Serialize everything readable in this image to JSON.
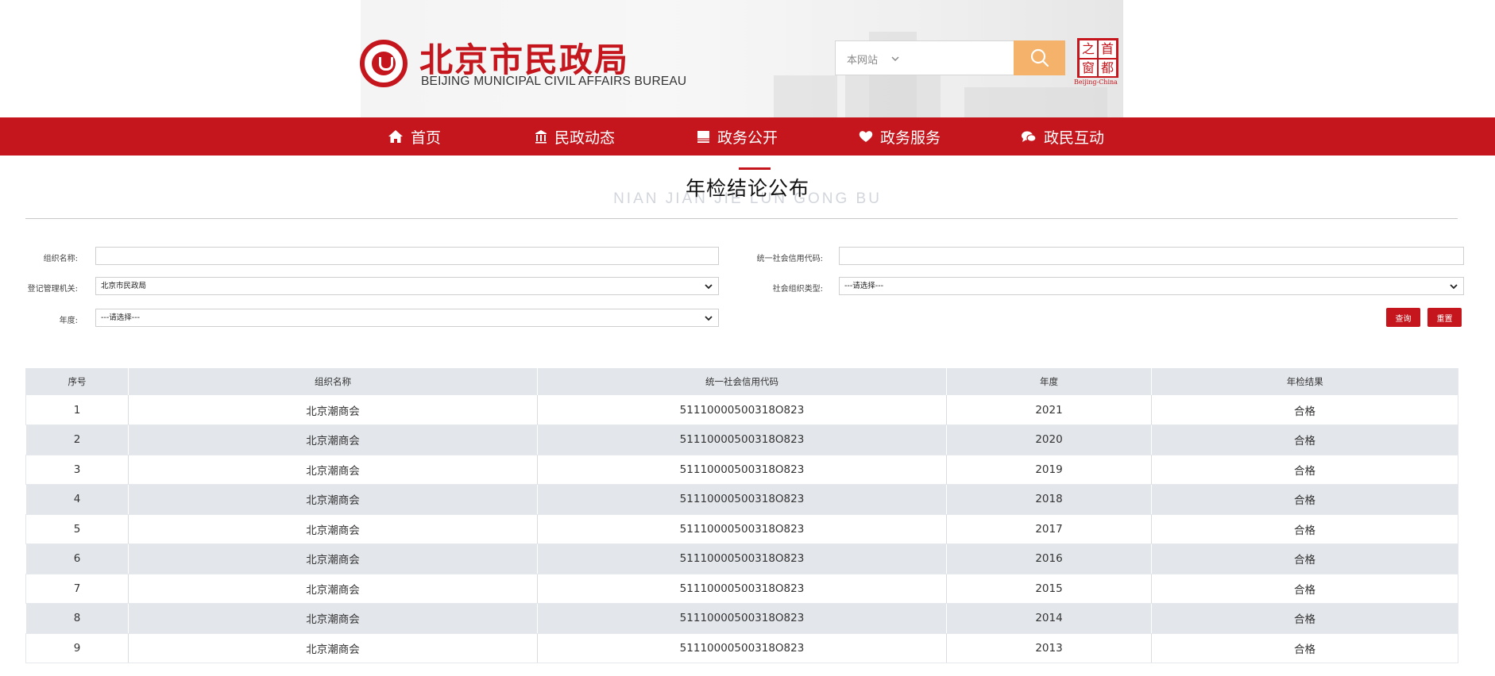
{
  "header": {
    "logo_cn": "北京市民政局",
    "logo_en": "BEIJING MUNICIPAL CIVIL AFFAIRS BUREAU",
    "search_scope": "本网站",
    "capital_logo": [
      "之",
      "首",
      "窗",
      "都"
    ],
    "capital_logo_sub": "Beijing-China"
  },
  "nav": {
    "items": [
      {
        "label": "首页",
        "icon": "home-icon"
      },
      {
        "label": "民政动态",
        "icon": "building-icon"
      },
      {
        "label": "政务公开",
        "icon": "book-icon"
      },
      {
        "label": "政务服务",
        "icon": "heart-icon"
      },
      {
        "label": "政民互动",
        "icon": "chat-icon"
      }
    ]
  },
  "page": {
    "title": "年检结论公布",
    "title_en": "NIAN JIAN JIE LUN GONG BU"
  },
  "form": {
    "org_name_label": "组织名称:",
    "org_name_value": "",
    "credit_code_label": "统一社会信用代码:",
    "credit_code_value": "",
    "authority_label": "登记管理机关:",
    "authority_value": "北京市民政局",
    "org_type_label": "社会组织类型:",
    "org_type_value": "---请选择---",
    "year_label": "年度:",
    "year_value": "---请选择---",
    "query_label": "查询",
    "reset_label": "重置"
  },
  "table": {
    "headers": [
      "序号",
      "组织名称",
      "统一社会信用代码",
      "年度",
      "年检结果"
    ],
    "rows": [
      [
        "1",
        "北京潮商会",
        "51110000500318O823",
        "2021",
        "合格"
      ],
      [
        "2",
        "北京潮商会",
        "51110000500318O823",
        "2020",
        "合格"
      ],
      [
        "3",
        "北京潮商会",
        "51110000500318O823",
        "2019",
        "合格"
      ],
      [
        "4",
        "北京潮商会",
        "51110000500318O823",
        "2018",
        "合格"
      ],
      [
        "5",
        "北京潮商会",
        "51110000500318O823",
        "2017",
        "合格"
      ],
      [
        "6",
        "北京潮商会",
        "51110000500318O823",
        "2016",
        "合格"
      ],
      [
        "7",
        "北京潮商会",
        "51110000500318O823",
        "2015",
        "合格"
      ],
      [
        "8",
        "北京潮商会",
        "51110000500318O823",
        "2014",
        "合格"
      ],
      [
        "9",
        "北京潮商会",
        "51110000500318O823",
        "2013",
        "合格"
      ]
    ]
  },
  "colors": {
    "brand_red": "#c4161c",
    "search_orange": "#f4b26a",
    "row_alt": "#e3e6ea"
  }
}
